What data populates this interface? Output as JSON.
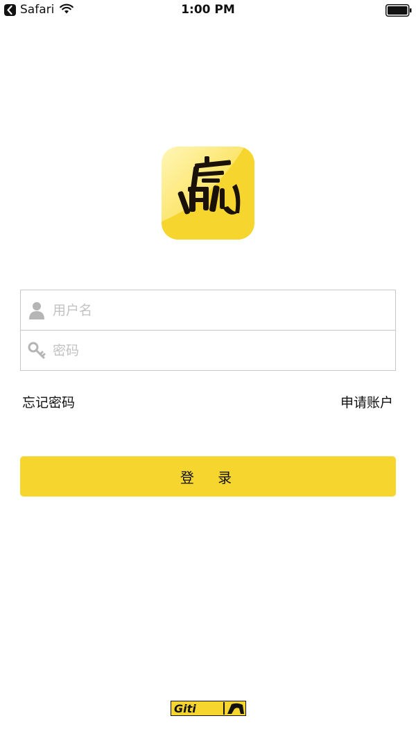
{
  "status_bar": {
    "back_app": "Safari",
    "time": "1:00 PM"
  },
  "icons": {
    "back": "chevron-left-icon",
    "wifi": "wifi-icon",
    "battery": "battery-icon",
    "user": "user-icon",
    "key": "key-icon"
  },
  "login": {
    "username_placeholder": "用户名",
    "password_placeholder": "密码",
    "forgot_password": "忘记密码",
    "register": "申请账户",
    "submit": "登 录"
  },
  "brand": {
    "footer_logo": "Giti"
  },
  "colors": {
    "accent": "#f7d52f",
    "border": "#c9c9c9",
    "placeholder": "#c2c2c2"
  }
}
